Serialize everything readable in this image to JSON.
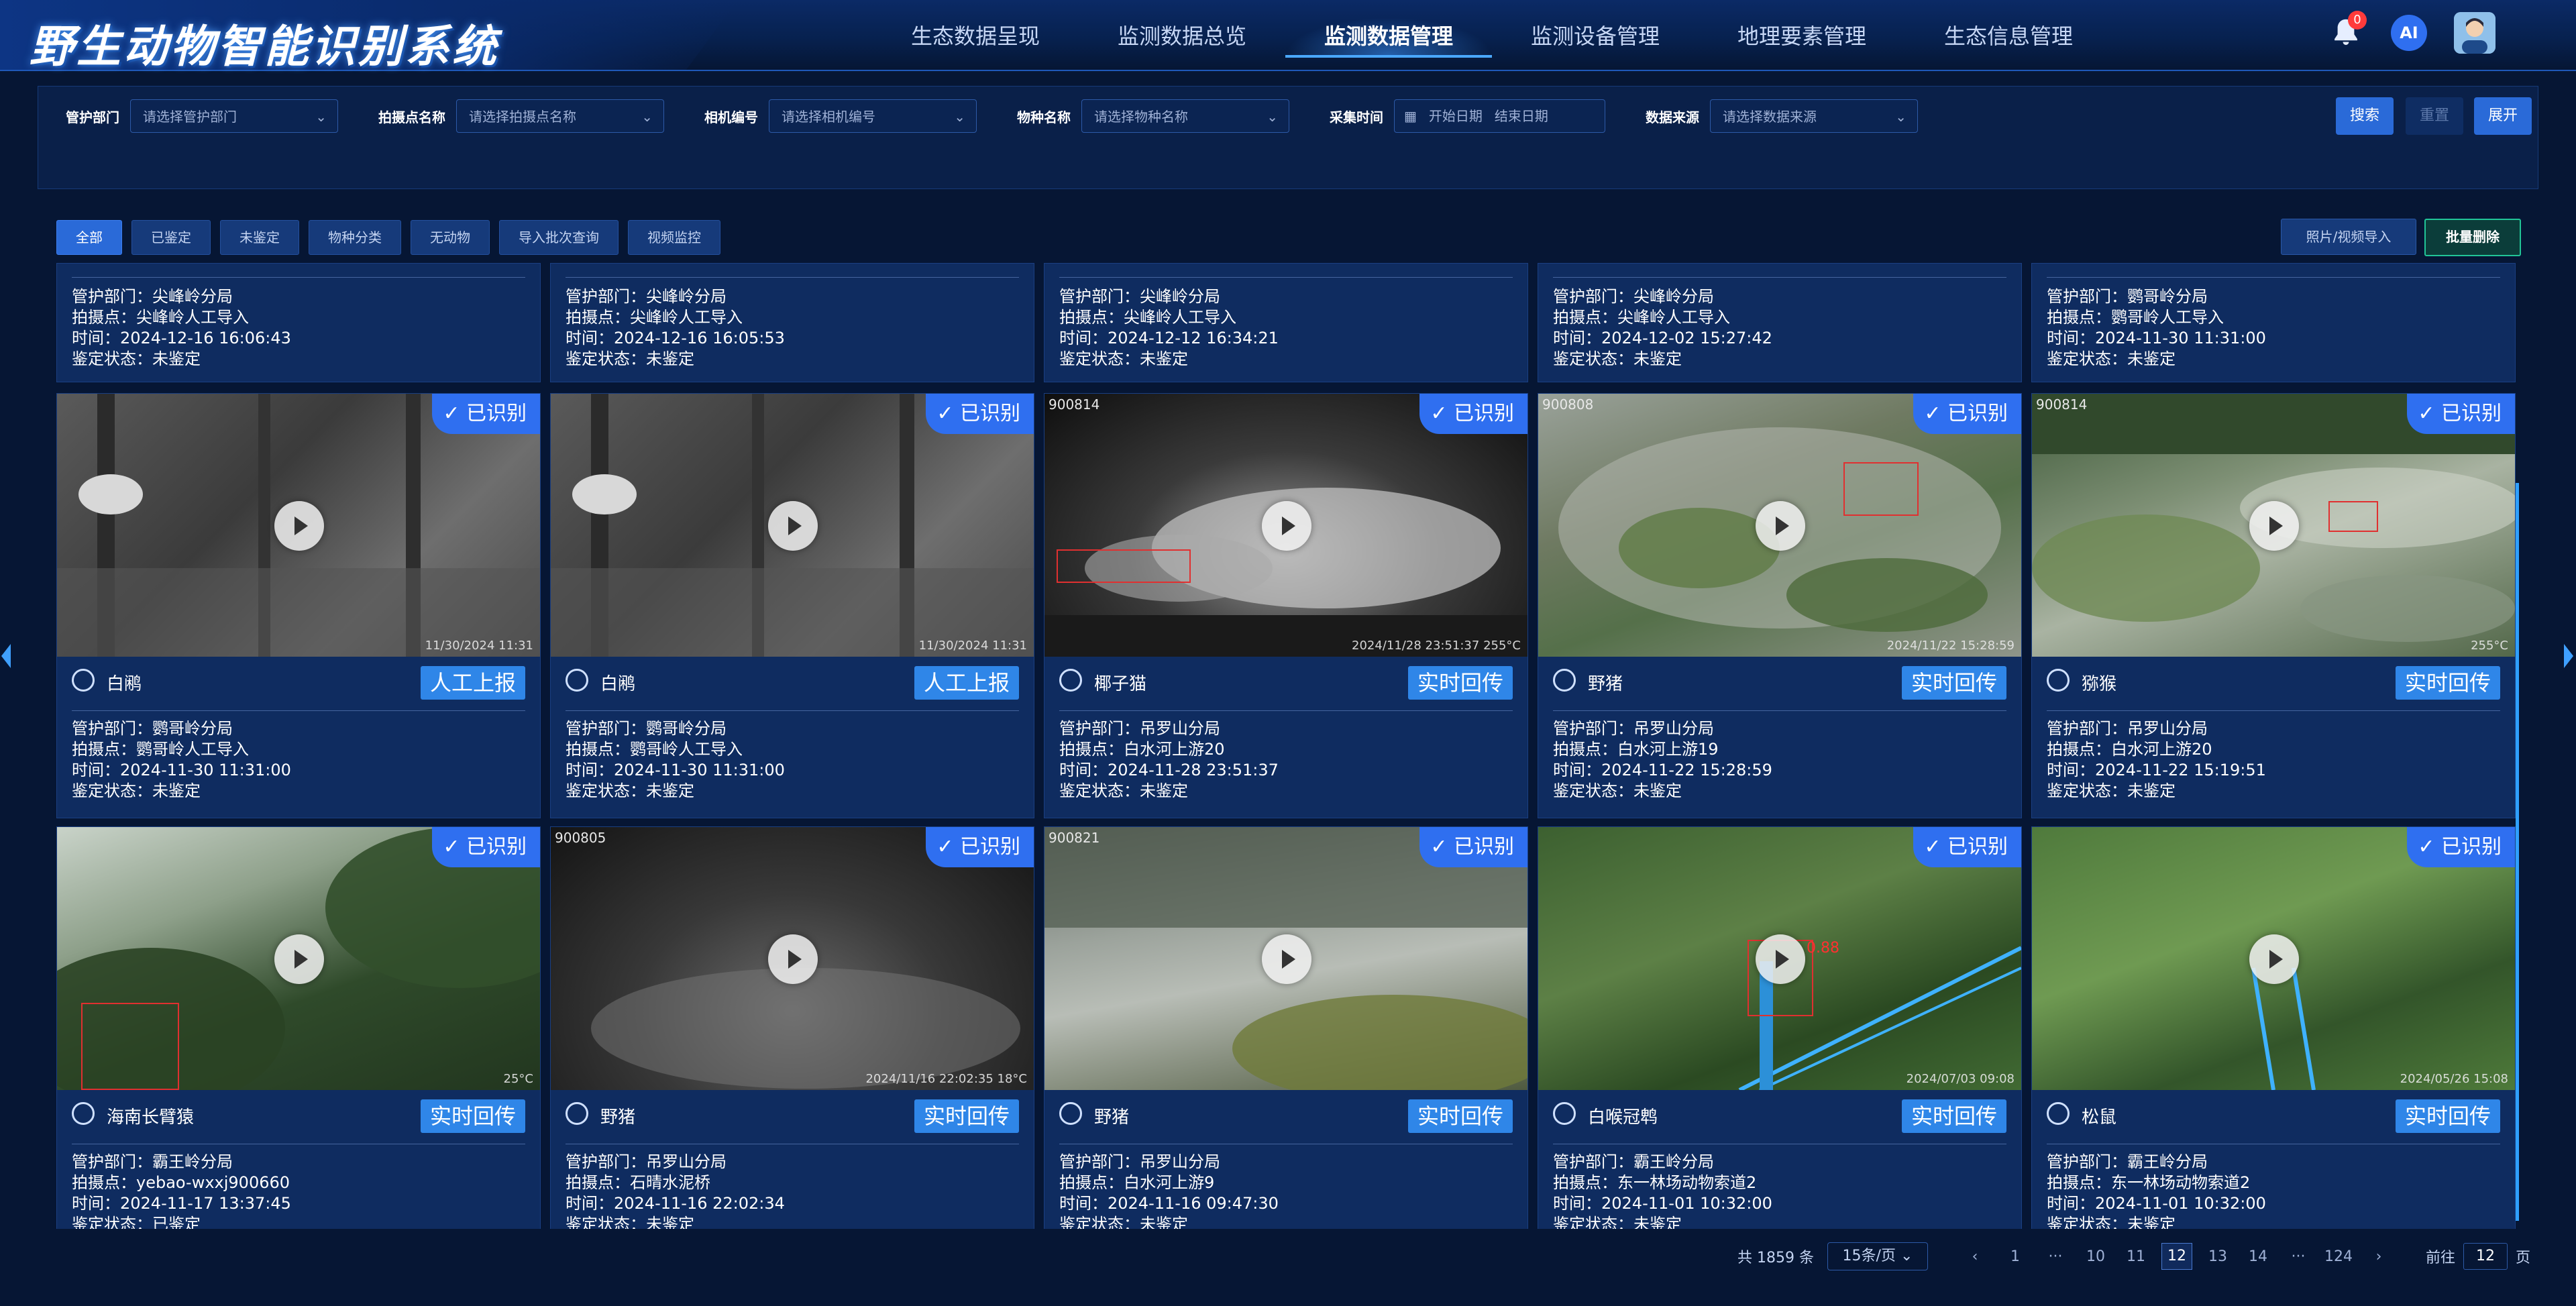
{
  "header": {
    "app_title": "野生动物智能识别系统",
    "nav": [
      "生态数据呈现",
      "监测数据总览",
      "监测数据管理",
      "监测设备管理",
      "地理要素管理",
      "生态信息管理"
    ],
    "active_nav": "监测数据管理",
    "notification_count": "0",
    "ai_label": "AI"
  },
  "filters": {
    "department": {
      "label": "管护部门",
      "placeholder": "请选择管护部门"
    },
    "location": {
      "label": "拍摄点名称",
      "placeholder": "请选择拍摄点名称"
    },
    "camera": {
      "label": "相机编号",
      "placeholder": "请选择相机编号"
    },
    "species": {
      "label": "物种名称",
      "placeholder": "请选择物种名称"
    },
    "time": {
      "label": "采集时间",
      "start": "开始日期",
      "end": "结束日期"
    },
    "source": {
      "label": "数据来源",
      "placeholder": "请选择数据来源"
    },
    "search": "搜索",
    "reset": "重置",
    "expand": "展开"
  },
  "tabs": [
    "全部",
    "已鉴定",
    "未鉴定",
    "物种分类",
    "无动物",
    "导入批次查询",
    "视频监控"
  ],
  "actions": {
    "import": "照片/视频导入",
    "batch_delete": "批量删除"
  },
  "labels": {
    "dept": "管护部门：",
    "point": "拍摄点：",
    "time": "时间：",
    "status": "鉴定状态：",
    "identified": "已识别"
  },
  "top_cards": [
    {
      "dept": "尖峰岭分局",
      "point": "尖峰岭人工导入",
      "time": "2024-12-16 16:06:43",
      "status": "未鉴定"
    },
    {
      "dept": "尖峰岭分局",
      "point": "尖峰岭人工导入",
      "time": "2024-12-16 16:05:53",
      "status": "未鉴定"
    },
    {
      "dept": "尖峰岭分局",
      "point": "尖峰岭人工导入",
      "time": "2024-12-12 16:34:21",
      "status": "未鉴定"
    },
    {
      "dept": "尖峰岭分局",
      "point": "尖峰岭人工导入",
      "time": "2024-12-02 15:27:42",
      "status": "未鉴定"
    },
    {
      "dept": "鹦哥岭分局",
      "point": "鹦哥岭人工导入",
      "time": "2024-11-30 11:31:00",
      "status": "未鉴定"
    }
  ],
  "cards_row2": [
    {
      "species": "白鹇",
      "action": "人工上报",
      "dept": "鹦哥岭分局",
      "point": "鹦哥岭人工导入",
      "time": "2024-11-30 11:31:00",
      "status": "未鉴定",
      "cam": "",
      "stamp": "11/30/2024 11:31"
    },
    {
      "species": "白鹇",
      "action": "人工上报",
      "dept": "鹦哥岭分局",
      "point": "鹦哥岭人工导入",
      "time": "2024-11-30 11:31:00",
      "status": "未鉴定",
      "cam": "",
      "stamp": "11/30/2024 11:31"
    },
    {
      "species": "椰子猫",
      "action": "实时回传",
      "dept": "吊罗山分局",
      "point": "白水河上游20",
      "time": "2024-11-28 23:51:37",
      "status": "未鉴定",
      "cam": "900814",
      "stamp": "2024/11/28 23:51:37  255°C"
    },
    {
      "species": "野猪",
      "action": "实时回传",
      "dept": "吊罗山分局",
      "point": "白水河上游19",
      "time": "2024-11-22 15:28:59",
      "status": "未鉴定",
      "cam": "900808",
      "stamp": "2024/11/22 15:28:59"
    },
    {
      "species": "猕猴",
      "action": "实时回传",
      "dept": "吊罗山分局",
      "point": "白水河上游20",
      "time": "2024-11-22 15:19:51",
      "status": "未鉴定",
      "cam": "900814",
      "stamp": "255°C"
    }
  ],
  "cards_row3": [
    {
      "species": "海南长臂猿",
      "action": "实时回传",
      "dept": "霸王岭分局",
      "point": "yebao-wxxj900660",
      "time": "2024-11-17 13:37:45",
      "status": "已鉴定",
      "cam": "",
      "stamp": "25°C"
    },
    {
      "species": "野猪",
      "action": "实时回传",
      "dept": "吊罗山分局",
      "point": "石晴水泥桥",
      "time": "2024-11-16 22:02:34",
      "status": "未鉴定",
      "cam": "900805",
      "stamp": "2024/11/16 22:02:35  18°C"
    },
    {
      "species": "野猪",
      "action": "实时回传",
      "dept": "吊罗山分局",
      "point": "白水河上游9",
      "time": "2024-11-16 09:47:30",
      "status": "未鉴定",
      "cam": "900821",
      "stamp": ""
    },
    {
      "species": "白喉冠鹎",
      "action": "实时回传",
      "dept": "霸王岭分局",
      "point": "东一林场动物索道2",
      "time": "2024-11-01 10:32:00",
      "status": "未鉴定",
      "cam": "",
      "stamp": "2024/07/03 09:08"
    },
    {
      "species": "松鼠",
      "action": "实时回传",
      "dept": "霸王岭分局",
      "point": "东一林场动物索道2",
      "time": "2024-11-01 10:32:00",
      "status": "未鉴定",
      "cam": "",
      "stamp": "2024/05/26 15:08"
    }
  ],
  "detections": {
    "bulbul_score": "0.88"
  },
  "pagination": {
    "total": "共 1859 条",
    "page_size": "15条/页",
    "pages": [
      "1",
      "···",
      "10",
      "11",
      "12",
      "13",
      "14",
      "···",
      "124"
    ],
    "current": "12",
    "goto_label": "前往",
    "goto_value": "12",
    "page_suffix": "页"
  },
  "colors": {
    "accent": "#2f6ff0",
    "report_button": "#2f86e8",
    "batch_delete_border": "#21c497"
  }
}
